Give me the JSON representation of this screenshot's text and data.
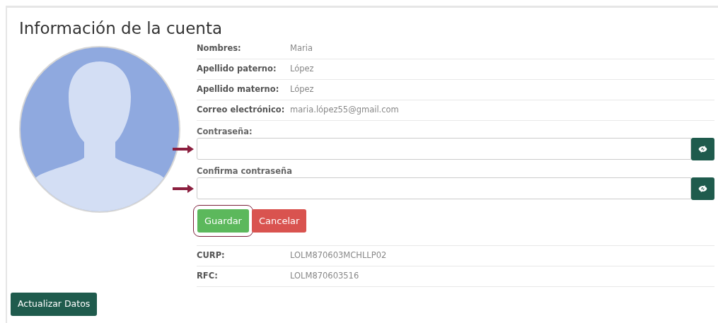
{
  "title": "Información de la cuenta",
  "avatar": {
    "kind": "silhouette"
  },
  "info_rows": [
    {
      "label": "Nombres:",
      "value": "Maria"
    },
    {
      "label": "Apellido paterno:",
      "value": "López"
    },
    {
      "label": "Apellido materno:",
      "value": "López"
    },
    {
      "label": "Correo electrónico:",
      "value": "maria.lópez55@gmail.com"
    }
  ],
  "password_fields": [
    {
      "label": "Contraseña:",
      "pointer": true
    },
    {
      "label": "Confirma contraseña",
      "pointer": true
    }
  ],
  "form_buttons": [
    {
      "label": "Guardar",
      "kind": "success",
      "highlighted": true
    },
    {
      "label": "Cancelar",
      "kind": "danger",
      "highlighted": false
    }
  ],
  "id_rows": [
    {
      "label": "CURP:",
      "value": "LOLM870603MCHLLP02"
    },
    {
      "label": "RFC:",
      "value": "LOLM870603516"
    }
  ],
  "update_button": {
    "label": "Actualizar Datos"
  }
}
